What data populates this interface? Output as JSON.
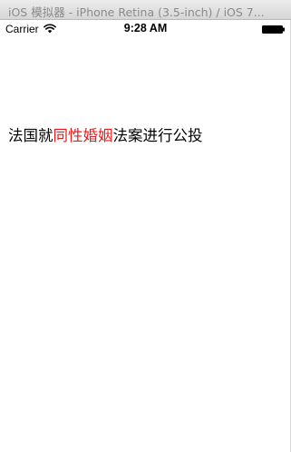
{
  "window": {
    "title": "iOS 模拟器 - iPhone Retina (3.5-inch) / iOS 7..."
  },
  "status_bar": {
    "carrier": "Carrier",
    "time": "9:28 AM",
    "icons": [
      "wifi-icon",
      "battery-icon"
    ]
  },
  "headline": {
    "prefix": "法国就",
    "highlight": "同性婚姻",
    "suffix": "法案进行公投",
    "highlight_color": "#e02020"
  }
}
